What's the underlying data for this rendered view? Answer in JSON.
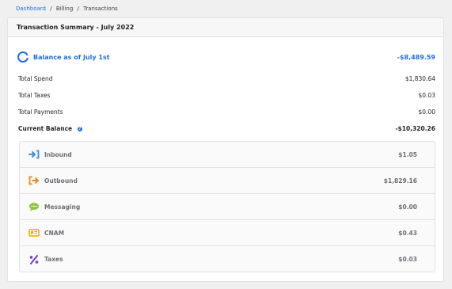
{
  "breadcrumb": {
    "items": [
      "Dashboard",
      "Billing",
      "Transactions"
    ],
    "separator": "/"
  },
  "summary": {
    "title": "Transaction Summary - July 2022",
    "balance_label": "Balance as of July 1st",
    "balance_value": "-$8,489.59",
    "lines": [
      {
        "label": "Total Spend",
        "value": "$1,830.64"
      },
      {
        "label": "Total Taxes",
        "value": "$0.03"
      },
      {
        "label": "Total Payments",
        "value": "$0.00"
      }
    ],
    "current_balance_label": "Current Balance",
    "current_balance_value": "-$10,320.26"
  },
  "breakdown": [
    {
      "label": "Inbound",
      "value": "$1.05",
      "icon": "inbound-arrow-icon",
      "color": "#3a8ee6"
    },
    {
      "label": "Outbound",
      "value": "$1,829.16",
      "icon": "outbound-arrow-icon",
      "color": "#f08a1c"
    },
    {
      "label": "Messaging",
      "value": "$0.00",
      "icon": "chat-bubble-icon",
      "color": "#8cc63f"
    },
    {
      "label": "CNAM",
      "value": "$0.43",
      "icon": "id-card-icon",
      "color": "#f2a900"
    },
    {
      "label": "Taxes",
      "value": "$0.03",
      "icon": "percent-icon",
      "color": "#6a3fc1"
    }
  ],
  "colors": {
    "accent": "#1f6fe0",
    "background": "#f0f0f1",
    "muted_text": "#6b6f76"
  }
}
